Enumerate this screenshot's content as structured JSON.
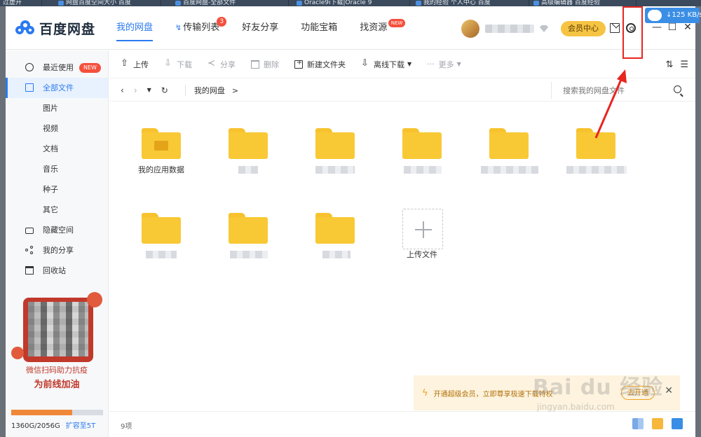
{
  "browser_tabs": [
    "过虚开",
    "网盘百度空间大小 百度",
    "百度网盘-全部文件",
    "Oracle9i下载|Oracle 9",
    "我的经验 个人中心 百度",
    "高级编辑器 百度经验"
  ],
  "app": {
    "name": "百度网盘",
    "nav": [
      {
        "label": "我的网盘"
      },
      {
        "label": "传输列表",
        "badge": "3"
      },
      {
        "label": "好友分享"
      },
      {
        "label": "功能宝箱"
      },
      {
        "label": "找资源",
        "badge": "NEW"
      }
    ],
    "vip_button": "会员中心",
    "window_controls": [
      "—",
      "☐",
      "✕"
    ],
    "speed_indicator": "↓125 KB/s"
  },
  "sidebar": {
    "items": [
      {
        "label": "最近使用",
        "badge": "NEW",
        "icon": "clock-icon"
      },
      {
        "label": "全部文件",
        "icon": "document-icon",
        "active": true
      },
      {
        "label": "图片"
      },
      {
        "label": "视频"
      },
      {
        "label": "文档"
      },
      {
        "label": "音乐"
      },
      {
        "label": "种子"
      },
      {
        "label": "其它"
      },
      {
        "label": "隐藏空间",
        "icon": "lock-icon"
      },
      {
        "label": "我的分享",
        "icon": "share-icon"
      },
      {
        "label": "回收站",
        "icon": "trash-icon"
      }
    ],
    "promo": {
      "line1": "微信扫码助力抗疫",
      "line2": "为前线加油"
    },
    "quota": {
      "used_fraction": 0.661,
      "text": "1360G/2056G",
      "expand": "扩容至5T"
    }
  },
  "toolbar": {
    "upload": "上传",
    "download": "下载",
    "share": "分享",
    "delete": "删除",
    "new_folder": "新建文件夹",
    "offline_download": "离线下载",
    "more": "更多"
  },
  "pathbar": {
    "crumb": "我的网盘",
    "sep": ">",
    "search_placeholder": "搜索我的网盘文件"
  },
  "files": [
    {
      "name": "我的应用数据",
      "type": "app-folder"
    },
    {
      "name": "",
      "type": "folder"
    },
    {
      "name": "",
      "type": "folder"
    },
    {
      "name": "",
      "type": "folder"
    },
    {
      "name": "",
      "type": "folder"
    },
    {
      "name": "",
      "type": "folder"
    },
    {
      "name": "",
      "type": "folder"
    },
    {
      "name": "",
      "type": "folder"
    },
    {
      "name": "",
      "type": "folder"
    }
  ],
  "upload_tile": "上传文件",
  "notice": {
    "text": "开通超级会员，立即尊享极速下载特权",
    "action": "去开通",
    "close": "✕"
  },
  "status": {
    "count": "9项"
  },
  "watermark": {
    "big": "Bai du 经验",
    "small": "jingyan.baidu.com"
  }
}
